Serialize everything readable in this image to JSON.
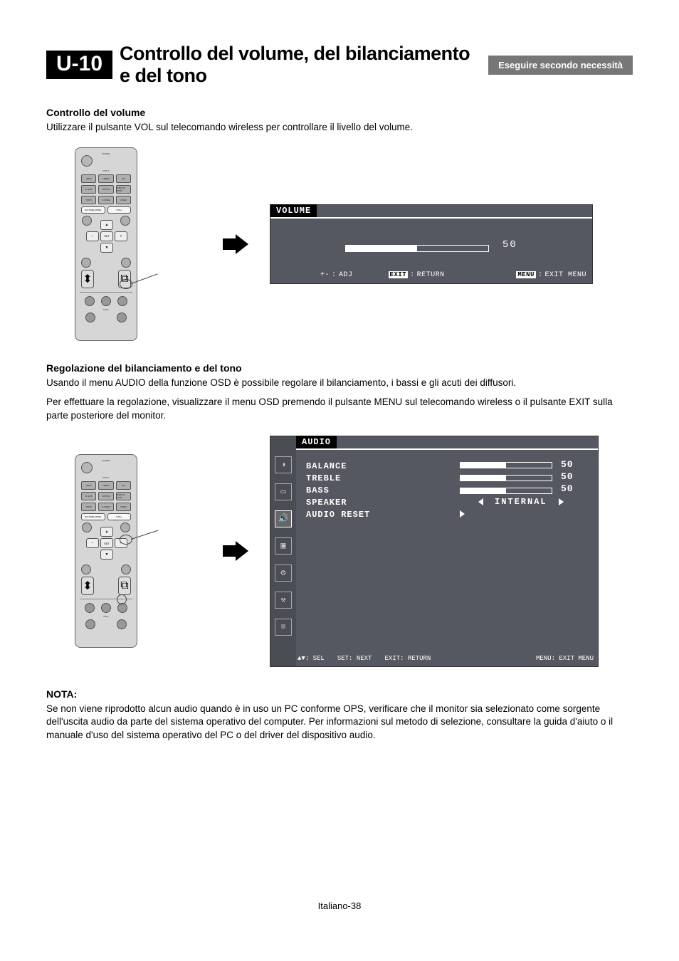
{
  "header": {
    "section_id": "U-10",
    "section_title": "Controllo del volume, del bilanciamento e del tono",
    "ribbon": "Eseguire secondo necessità"
  },
  "vol_section": {
    "heading": "Controllo del volume",
    "desc": "Utilizzare il pulsante VOL sul telecomando wireless per controllare il livello del volume."
  },
  "osd_vol": {
    "title": "VOLUME",
    "value": "50",
    "hint_adj_sym": "+-",
    "hint_adj": "ADJ",
    "hint_exit_key": "EXIT",
    "hint_return": "RETURN",
    "hint_menu_key": "MENU",
    "hint_exitmenu": "EXIT MENU"
  },
  "balance_section": {
    "heading": "Regolazione del bilanciamento e del tono",
    "p1": "Usando il menu AUDIO della funzione OSD è possibile regolare il bilanciamento, i bassi e gli acuti dei diffusori.",
    "p2": "Per effettuare la regolazione, visualizzare il menu OSD premendo il pulsante MENU sul telecomando wireless o il pulsante EXIT sulla parte posteriore del monitor."
  },
  "osd_audio": {
    "title": "AUDIO",
    "items": {
      "balance": "BALANCE",
      "treble": "TREBLE",
      "bass": "BASS",
      "speaker": "SPEAKER",
      "reset": "AUDIO RESET"
    },
    "vals": {
      "balance": "50",
      "treble": "50",
      "bass": "50"
    },
    "speaker_val": "INTERNAL",
    "hint_sel_sym": "▲▼",
    "hint_sel": "SEL",
    "hint_set_key": "SET",
    "hint_next": "NEXT",
    "hint_exit_key": "EXIT",
    "hint_return": "RETURN",
    "hint_menu_key": "MENU",
    "hint_exitmenu": "EXIT MENU"
  },
  "note": {
    "heading": "NOTA:",
    "body": "Se non viene riprodotto alcun audio quando è in uso un PC conforme OPS, verificare che il monitor sia selezionato come sorgente dell'uscita audio da parte del sistema operativo del computer. Per informazioni sul metodo di selezione, consultare la guida d'aiuto o il manuale d'uso del sistema operativo del PC o del driver del dispositivo audio."
  },
  "footer": "Italiano-38",
  "remote": {
    "row1": [
      "HDMI",
      "HDMI2",
      "DVI"
    ],
    "row2": [
      "D-SUB",
      "OPTION",
      "DISPLAY PORT"
    ],
    "row3": [
      "YPbPr",
      "S-VIDEO",
      "VIDEO"
    ],
    "row4": [
      "PICTURE MODE",
      "",
      "STILL"
    ],
    "minus": "−",
    "plus": "+",
    "set": "SET",
    "bottom_labels": [
      "POWER",
      "INPUT",
      ""
    ]
  }
}
